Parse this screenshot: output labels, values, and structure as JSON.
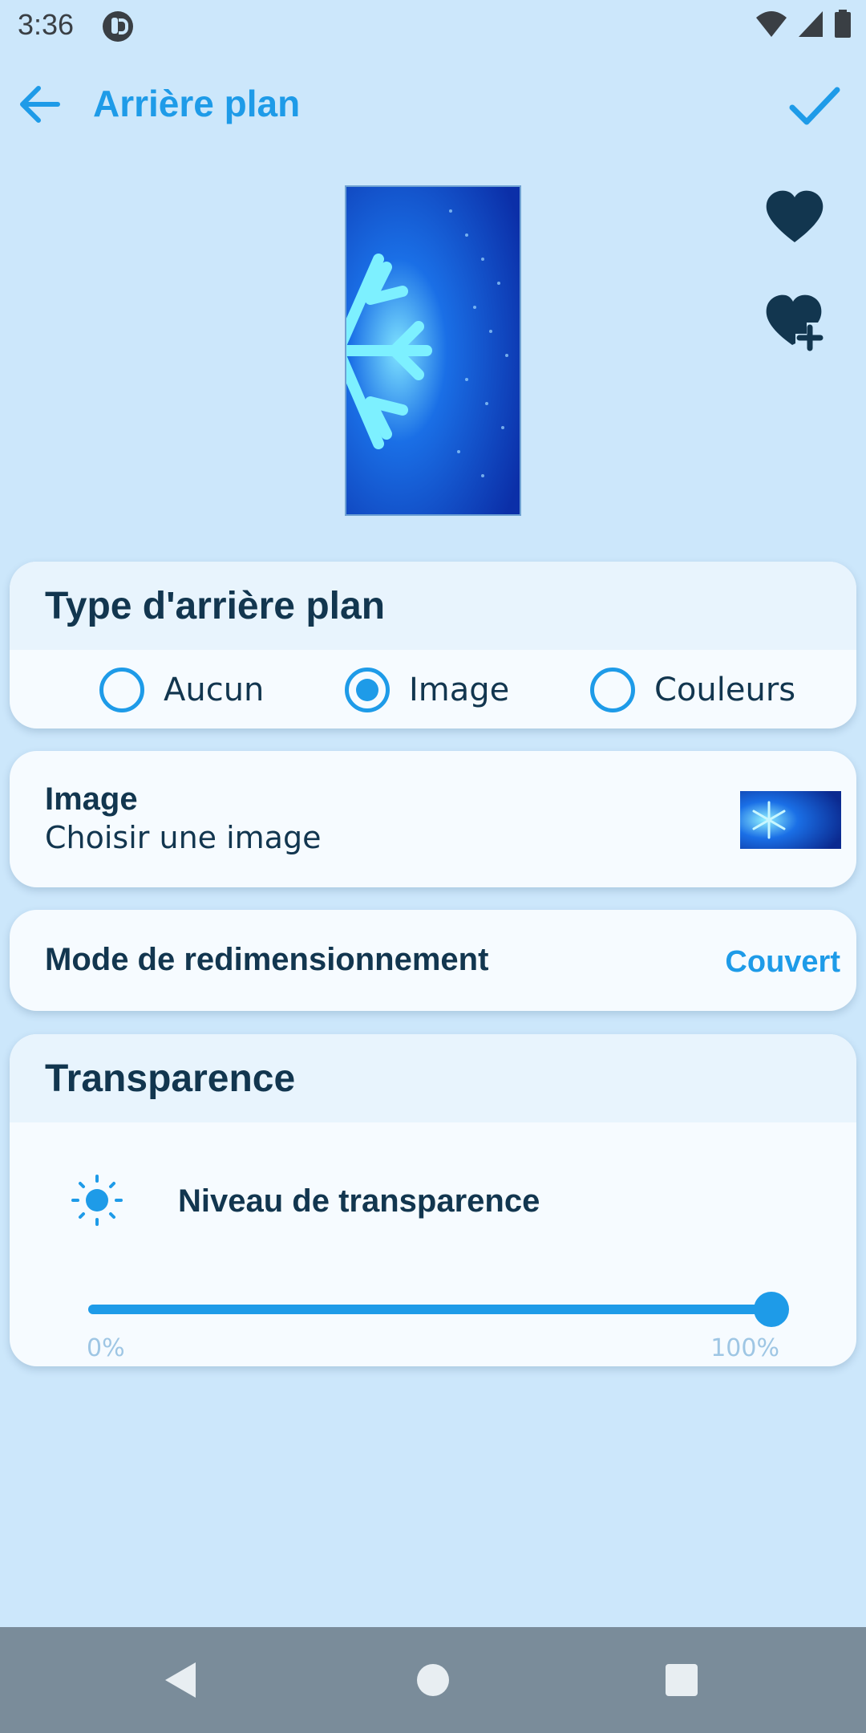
{
  "status_bar": {
    "time": "3:36"
  },
  "app_bar": {
    "title": "Arrière plan"
  },
  "background_type": {
    "title": "Type d'arrière plan",
    "options": [
      {
        "label": "Aucun",
        "selected": false
      },
      {
        "label": "Image",
        "selected": true
      },
      {
        "label": "Couleurs",
        "selected": false
      }
    ]
  },
  "image_card": {
    "title": "Image",
    "subtitle": "Choisir une image"
  },
  "resize_card": {
    "label": "Mode de redimensionnement",
    "value": "Couvert"
  },
  "transparency": {
    "title": "Transparence",
    "level_label": "Niveau de transparence",
    "value_percent": 100,
    "min_label": "0%",
    "max_label": "100%"
  },
  "colors": {
    "accent": "#1e9be8",
    "background": "#cce7fb",
    "text": "#12364f"
  },
  "icons": [
    "back-arrow-icon",
    "check-icon",
    "heart-icon",
    "heart-plus-icon",
    "sun-icon",
    "nav-back-icon",
    "nav-home-icon",
    "nav-recents-icon"
  ]
}
